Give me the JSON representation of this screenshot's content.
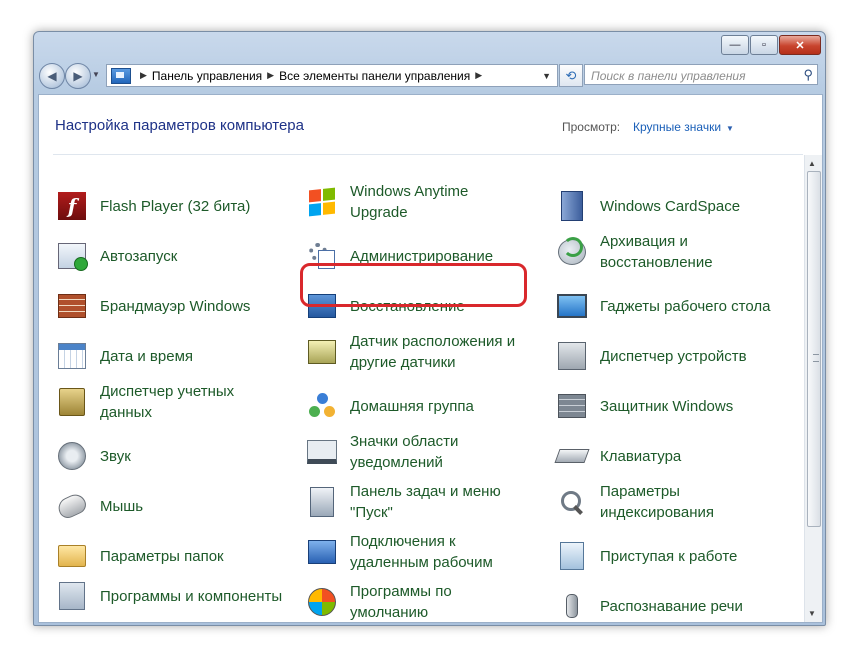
{
  "window": {
    "min_label": "—",
    "max_label": "▫",
    "close_label": "✕"
  },
  "address": {
    "crumbs": [
      "Панель управления",
      "Все элементы панели управления"
    ]
  },
  "search": {
    "placeholder": "Поиск в панели управления"
  },
  "header": {
    "title": "Настройка параметров компьютера",
    "view_label": "Просмотр:",
    "view_value": "Крупные значки"
  },
  "items": {
    "col1": [
      {
        "label": "Flash Player (32 бита)",
        "icon": "flash-icon"
      },
      {
        "label": "Автозапуск",
        "icon": "autoplay-icon"
      },
      {
        "label": "Брандмауэр Windows",
        "icon": "firewall-icon"
      },
      {
        "label": "Дата и время",
        "icon": "calendar-icon"
      },
      {
        "label": "Диспетчер учетных данных",
        "icon": "vault-icon"
      },
      {
        "label": "Звук",
        "icon": "speaker-icon"
      },
      {
        "label": "Мышь",
        "icon": "mouse-icon"
      },
      {
        "label": "Параметры папок",
        "icon": "folder-icon"
      },
      {
        "label": "Программы и компоненты",
        "icon": "programs-icon"
      }
    ],
    "col2": [
      {
        "label": "Windows Anytime Upgrade",
        "icon": "windows-logo-icon"
      },
      {
        "label": "Администрирование",
        "icon": "admin-tools-icon"
      },
      {
        "label": "Восстановление",
        "icon": "recovery-icon"
      },
      {
        "label": "Датчик расположения и другие датчики",
        "icon": "sensor-icon"
      },
      {
        "label": "Домашняя группа",
        "icon": "homegroup-icon"
      },
      {
        "label": "Значки области уведомлений",
        "icon": "notification-tray-icon"
      },
      {
        "label": "Панель задач и меню \"Пуск\"",
        "icon": "taskbar-icon"
      },
      {
        "label": "Подключения к удаленным рабочим",
        "icon": "remote-desktop-icon"
      },
      {
        "label": "Программы по умолчанию",
        "icon": "default-programs-icon"
      }
    ],
    "col3": [
      {
        "label": "Windows CardSpace",
        "icon": "cardspace-icon"
      },
      {
        "label": "Архивация и восстановление",
        "icon": "backup-icon"
      },
      {
        "label": "Гаджеты рабочего стола",
        "icon": "gadgets-icon"
      },
      {
        "label": "Диспетчер устройств",
        "icon": "device-manager-icon"
      },
      {
        "label": "Защитник Windows",
        "icon": "defender-icon"
      },
      {
        "label": "Клавиатура",
        "icon": "keyboard-icon"
      },
      {
        "label": "Параметры индексирования",
        "icon": "indexing-icon"
      },
      {
        "label": "Приступая к работе",
        "icon": "getting-started-icon"
      },
      {
        "label": "Распознавание речи",
        "icon": "microphone-icon"
      }
    ]
  },
  "highlight_color": "#d9282c",
  "link_color": "#1d5a29"
}
